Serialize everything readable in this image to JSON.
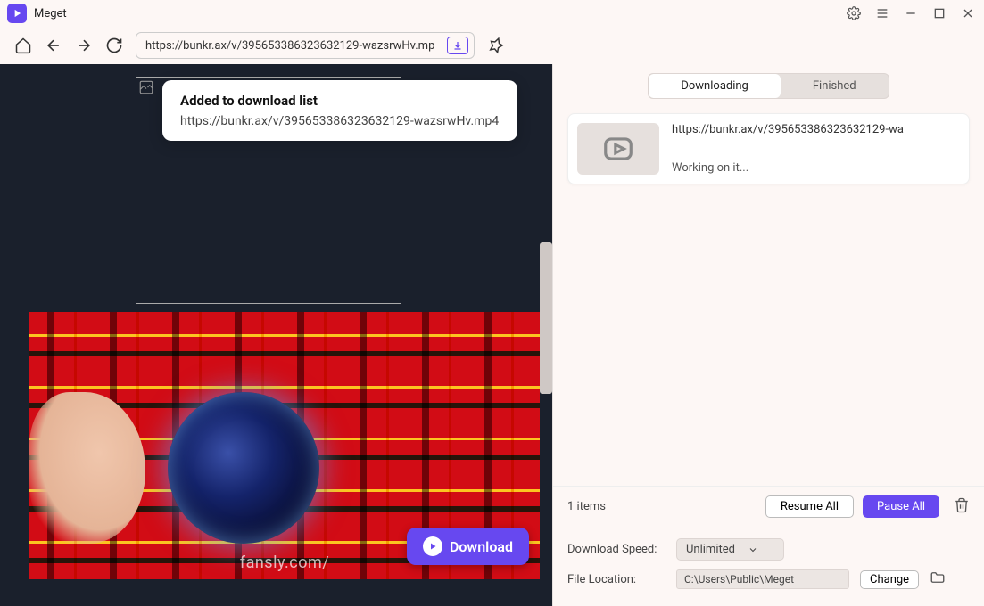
{
  "app": {
    "name": "Meget"
  },
  "toolbar": {
    "url": "https://bunkr.ax/v/395653386323632129-wazsrwHv.mp"
  },
  "toast": {
    "title": "Added to download list",
    "url": "https://bunkr.ax/v/395653386323632129-wazsrwHv.mp4"
  },
  "video": {
    "watermark": "fansly.com/",
    "download_label": "Download"
  },
  "tabs": {
    "downloading": "Downloading",
    "finished": "Finished"
  },
  "downloads": {
    "item0": {
      "url": "https://bunkr.ax/v/395653386323632129-wa",
      "status": "Working on it..."
    }
  },
  "items_bar": {
    "count": "1 items",
    "resume": "Resume All",
    "pause": "Pause All"
  },
  "settings": {
    "speed_label": "Download Speed:",
    "speed_value": "Unlimited",
    "location_label": "File Location:",
    "location_value": "C:\\Users\\Public\\Meget",
    "change": "Change"
  }
}
